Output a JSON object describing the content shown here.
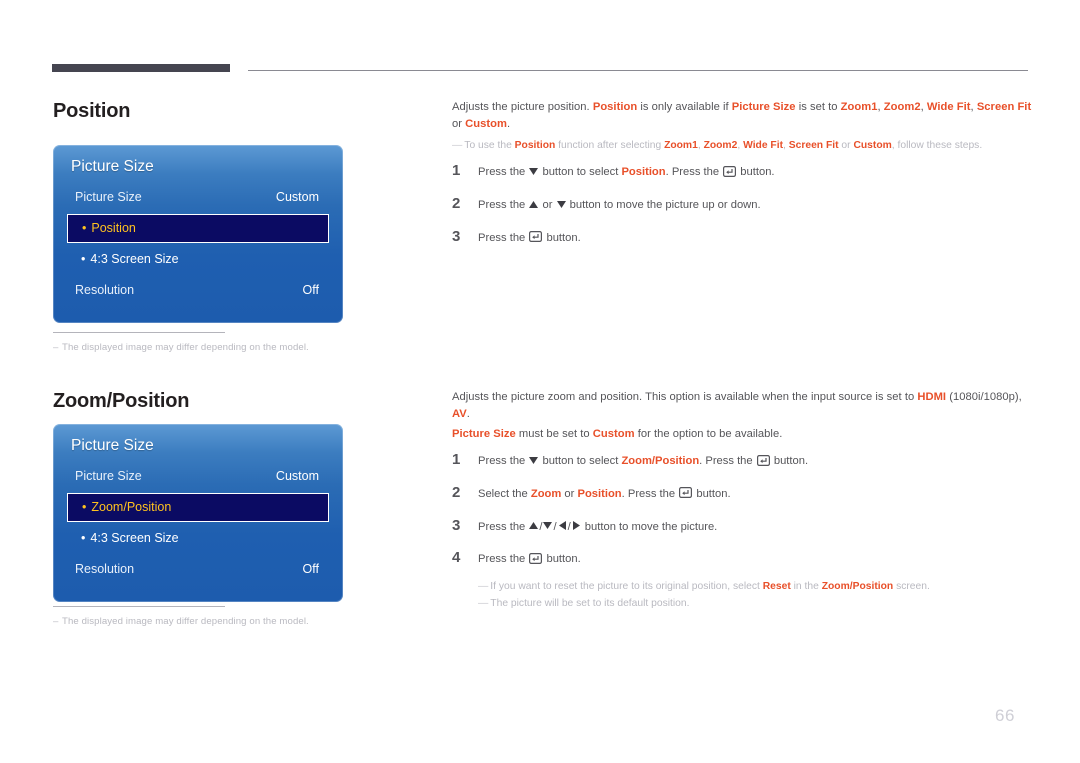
{
  "page": {
    "number": "66"
  },
  "sections": [
    {
      "heading": "Position",
      "osd": {
        "title": "Picture Size",
        "rows": [
          {
            "label": "Picture Size",
            "value": "Custom"
          }
        ],
        "sub_items": [
          {
            "label": "Position",
            "selected": true
          },
          {
            "label": "4:3 Screen Size",
            "selected": false
          }
        ],
        "footer_row": {
          "label": "Resolution",
          "value": "Off"
        }
      },
      "note": "The displayed image may differ depending on the model.",
      "description": {
        "line1_parts": [
          {
            "t": "Adjusts the picture position. ",
            "b": false
          },
          {
            "t": "Position",
            "b": true
          },
          {
            "t": " is only available if ",
            "b": false
          },
          {
            "t": "Picture Size",
            "b": true
          },
          {
            "t": " is set to ",
            "b": false
          },
          {
            "t": "Zoom1",
            "b": true
          },
          {
            "t": ", ",
            "b": false
          },
          {
            "t": "Zoom2",
            "b": true
          },
          {
            "t": ", ",
            "b": false
          },
          {
            "t": "Wide Fit",
            "b": true
          },
          {
            "t": ", ",
            "b": false
          },
          {
            "t": "Screen Fit",
            "b": true
          },
          {
            "t": " or ",
            "b": false
          },
          {
            "t": "Custom",
            "b": true
          },
          {
            "t": ".",
            "b": false
          }
        ],
        "subnote_parts": [
          {
            "t": "To use the ",
            "b": false
          },
          {
            "t": "Position",
            "b": true
          },
          {
            "t": " function after selecting ",
            "b": false
          },
          {
            "t": "Zoom1",
            "b": true
          },
          {
            "t": ", ",
            "b": false
          },
          {
            "t": "Zoom2",
            "b": true
          },
          {
            "t": ", ",
            "b": false
          },
          {
            "t": "Wide Fit",
            "b": true
          },
          {
            "t": ", ",
            "b": false
          },
          {
            "t": "Screen Fit",
            "b": true
          },
          {
            "t": " or ",
            "b": false
          },
          {
            "t": "Custom",
            "b": true
          },
          {
            "t": ", follow these steps.",
            "b": false
          }
        ]
      },
      "steps": [
        {
          "num": "1",
          "parts": [
            {
              "t": "Press the ",
              "b": false
            },
            {
              "icon": "arrow-down"
            },
            {
              "t": " button to select ",
              "b": false
            },
            {
              "t": "Position",
              "b": true
            },
            {
              "t": ". Press the ",
              "b": false
            },
            {
              "icon": "enter-button"
            },
            {
              "t": " button.",
              "b": false
            }
          ]
        },
        {
          "num": "2",
          "parts": [
            {
              "t": "Press the ",
              "b": false
            },
            {
              "icon": "arrow-up"
            },
            {
              "t": " or ",
              "b": false
            },
            {
              "icon": "arrow-down"
            },
            {
              "t": " button to move the picture up or down.",
              "b": false
            }
          ]
        },
        {
          "num": "3",
          "parts": [
            {
              "t": "Press the ",
              "b": false
            },
            {
              "icon": "enter-button"
            },
            {
              "t": " button.",
              "b": false
            }
          ]
        }
      ],
      "tail_notes": []
    },
    {
      "heading": "Zoom/Position",
      "osd": {
        "title": "Picture Size",
        "rows": [
          {
            "label": "Picture Size",
            "value": "Custom"
          }
        ],
        "sub_items": [
          {
            "label": "Zoom/Position",
            "selected": true
          },
          {
            "label": "4:3 Screen Size",
            "selected": false
          }
        ],
        "footer_row": {
          "label": "Resolution",
          "value": "Off"
        }
      },
      "note": "The displayed image may differ depending on the model.",
      "description": {
        "line1_parts": [
          {
            "t": "Adjusts the picture zoom and position. This option is available when the input source is set to ",
            "b": false
          },
          {
            "t": "HDMI",
            "b": true
          },
          {
            "t": " (1080i/1080p), ",
            "b": false
          },
          {
            "t": "AV",
            "b": true
          },
          {
            "t": ".",
            "b": false
          }
        ],
        "line2_parts": [
          {
            "t": "Picture Size",
            "b": true
          },
          {
            "t": " must be set to ",
            "b": false
          },
          {
            "t": "Custom",
            "b": true
          },
          {
            "t": " for the option to be available.",
            "b": false
          }
        ]
      },
      "steps": [
        {
          "num": "1",
          "parts": [
            {
              "t": "Press the ",
              "b": false
            },
            {
              "icon": "arrow-down"
            },
            {
              "t": " button to select ",
              "b": false
            },
            {
              "t": "Zoom/Position",
              "b": true
            },
            {
              "t": ". Press the ",
              "b": false
            },
            {
              "icon": "enter-button"
            },
            {
              "t": " button.",
              "b": false
            }
          ]
        },
        {
          "num": "2",
          "parts": [
            {
              "t": "Select the ",
              "b": false
            },
            {
              "t": "Zoom",
              "b": true
            },
            {
              "t": " or ",
              "b": false
            },
            {
              "t": "Position",
              "b": true
            },
            {
              "t": ". Press the ",
              "b": false
            },
            {
              "icon": "enter-button"
            },
            {
              "t": " button.",
              "b": false
            }
          ]
        },
        {
          "num": "3",
          "parts": [
            {
              "t": "Press the ",
              "b": false
            },
            {
              "icon": "arrow-up"
            },
            {
              "t": "/",
              "b": false
            },
            {
              "icon": "arrow-down"
            },
            {
              "t": "/",
              "b": false
            },
            {
              "icon": "arrow-left"
            },
            {
              "t": "/",
              "b": false
            },
            {
              "icon": "arrow-right"
            },
            {
              "t": " button to move the picture.",
              "b": false
            }
          ]
        },
        {
          "num": "4",
          "parts": [
            {
              "t": "Press the ",
              "b": false
            },
            {
              "icon": "enter-button"
            },
            {
              "t": " button.",
              "b": false
            }
          ]
        }
      ],
      "tail_notes": [
        [
          {
            "t": "If you want to reset the picture to its original position, select ",
            "b": false
          },
          {
            "t": "Reset",
            "b": true
          },
          {
            "t": " in the ",
            "b": false
          },
          {
            "t": "Zoom/Position",
            "b": true
          },
          {
            "t": " screen.",
            "b": false
          }
        ],
        [
          {
            "t": "The picture will be set to its default position.",
            "b": false
          }
        ]
      ]
    }
  ],
  "colors": {
    "accent_orange": "#e8502a",
    "osd_blue_top": "#5d9ad4",
    "osd_blue_bottom": "#1d5cae",
    "osd_selected_bg": "#0b0b63",
    "osd_selected_text": "#ffc21f",
    "rule_dark": "#454550",
    "muted_text": "#b9b9c0"
  }
}
